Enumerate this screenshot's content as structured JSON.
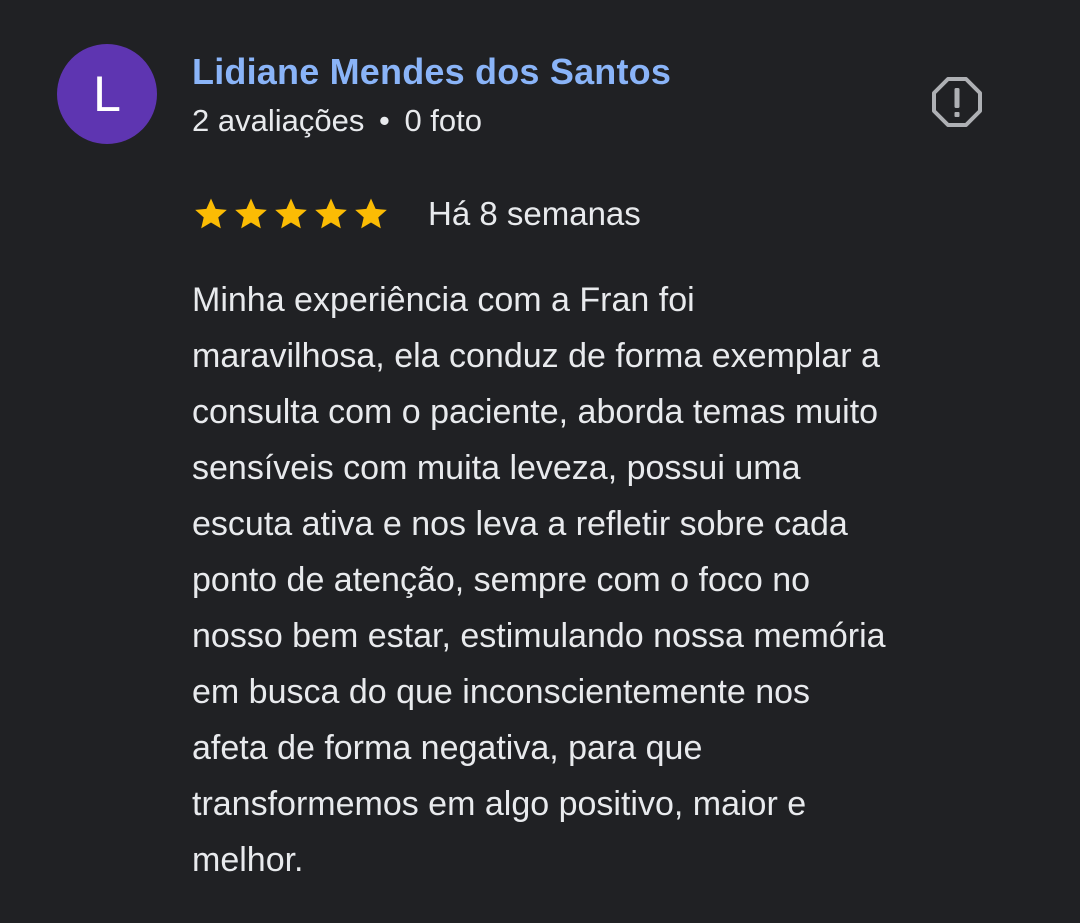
{
  "reviewer": {
    "initial": "L",
    "avatar_color": "#5e35b1",
    "name": "Lidiane Mendes dos Santos",
    "name_color": "#8ab4f8",
    "reviews_count": "2 avaliações",
    "separator": "•",
    "photos_count": "0 foto"
  },
  "actions": {
    "report_icon": "report-icon"
  },
  "review": {
    "rating": 5,
    "rating_max": 5,
    "star_color": "#fbbc04",
    "date": "Há 8 semanas",
    "text": "Minha experiência com a Fran foi\nmaravilhosa, ela conduz de forma exemplar a\nconsulta com o paciente, aborda temas muito\nsensíveis com muita leveza, possui uma\nescuta ativa e nos leva a refletir sobre cada\nponto de atenção, sempre com o foco no\nnosso bem estar, estimulando nossa memória\nem busca do que inconscientemente nos\nafeta de forma negativa, para que\ntransformemos em algo positivo, maior e\nmelhor."
  }
}
